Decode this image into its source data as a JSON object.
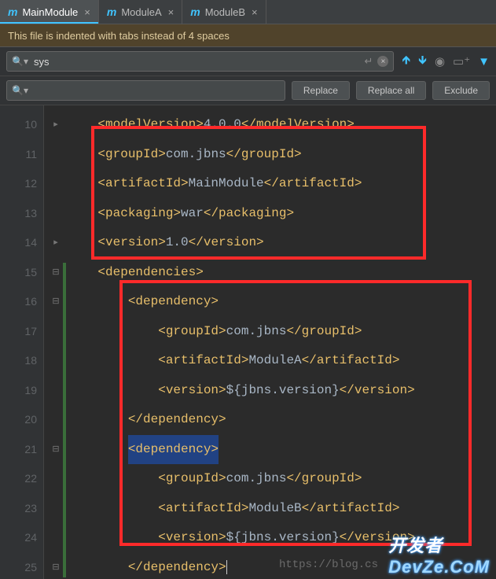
{
  "tabs": [
    {
      "label": "MainModule",
      "active": true
    },
    {
      "label": "ModuleA",
      "active": false
    },
    {
      "label": "ModuleB",
      "active": false
    }
  ],
  "warning": "This file is indented with tabs instead of 4 spaces",
  "search": {
    "value": "sys"
  },
  "replace": {
    "value": ""
  },
  "buttons": {
    "replace": "Replace",
    "replace_all": "Replace all",
    "exclude": "Exclude"
  },
  "line_numbers": [
    "10",
    "11",
    "12",
    "13",
    "14",
    "15",
    "16",
    "17",
    "18",
    "19",
    "20",
    "21",
    "22",
    "23",
    "24",
    "25"
  ],
  "code": [
    {
      "indent": 1,
      "tag": "modelVersion",
      "text": "4.0.0",
      "close": true
    },
    {
      "indent": 1,
      "tag": "groupId",
      "text": "com.jbns",
      "close": true
    },
    {
      "indent": 1,
      "tag": "artifactId",
      "text": "MainModule",
      "close": true
    },
    {
      "indent": 1,
      "tag": "packaging",
      "text": "war",
      "close": true
    },
    {
      "indent": 1,
      "tag": "version",
      "text": "1.0",
      "close": true
    },
    {
      "indent": 1,
      "open": "dependencies"
    },
    {
      "indent": 2,
      "open": "dependency"
    },
    {
      "indent": 3,
      "tag": "groupId",
      "text": "com.jbns",
      "close": true
    },
    {
      "indent": 3,
      "tag": "artifactId",
      "text": "ModuleA",
      "close": true
    },
    {
      "indent": 3,
      "tag": "version",
      "text": "${jbns.version}",
      "close": true
    },
    {
      "indent": 2,
      "closeTag": "dependency"
    },
    {
      "indent": 2,
      "open": "dependency",
      "highlight": true
    },
    {
      "indent": 3,
      "tag": "groupId",
      "text": "com.jbns",
      "close": true
    },
    {
      "indent": 3,
      "tag": "artifactId",
      "text": "ModuleB",
      "close": true
    },
    {
      "indent": 3,
      "tag": "version",
      "text": "${jbns.version}",
      "close": true
    },
    {
      "indent": 2,
      "closeTag": "dependency",
      "caret": true
    }
  ],
  "url_hint": "https://blog.cs",
  "watermark": {
    "a": "开发者",
    "b": "DevZe.CoM"
  }
}
